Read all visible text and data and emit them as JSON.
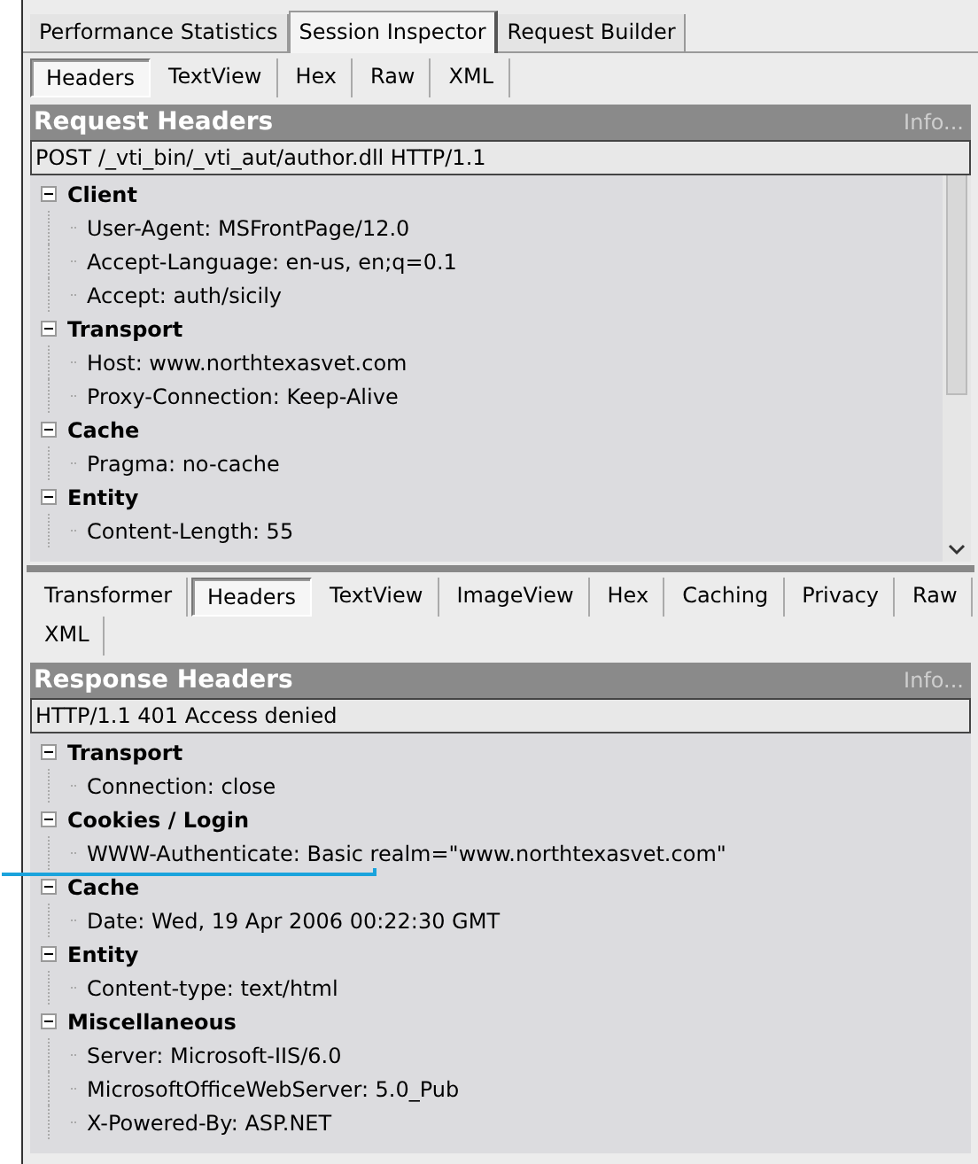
{
  "main_tabs": [
    {
      "label": "Performance Statistics",
      "selected": false
    },
    {
      "label": "Session Inspector",
      "selected": true
    },
    {
      "label": "Request Builder",
      "selected": false
    }
  ],
  "request": {
    "tabs": [
      {
        "label": "Headers",
        "selected": true
      },
      {
        "label": "TextView",
        "selected": false
      },
      {
        "label": "Hex",
        "selected": false
      },
      {
        "label": "Raw",
        "selected": false
      },
      {
        "label": "XML",
        "selected": false
      }
    ],
    "title": "Request Headers",
    "info": "Info...",
    "status_line": "POST /_vti_bin/_vti_aut/author.dll HTTP/1.1",
    "tree": [
      {
        "label": "Client",
        "expanded": true,
        "children": [
          {
            "label": "User-Agent: MSFrontPage/12.0"
          },
          {
            "label": "Accept-Language: en-us, en;q=0.1"
          },
          {
            "label": "Accept: auth/sicily"
          }
        ]
      },
      {
        "label": "Transport",
        "expanded": true,
        "children": [
          {
            "label": "Host: www.northtexasvet.com"
          },
          {
            "label": "Proxy-Connection: Keep-Alive"
          }
        ]
      },
      {
        "label": "Cache",
        "expanded": true,
        "children": [
          {
            "label": "Pragma: no-cache"
          }
        ]
      },
      {
        "label": "Entity",
        "expanded": true,
        "children": [
          {
            "label": "Content-Length: 55"
          }
        ]
      }
    ]
  },
  "response": {
    "tabs": [
      {
        "label": "Transformer",
        "selected": false
      },
      {
        "label": "Headers",
        "selected": true
      },
      {
        "label": "TextView",
        "selected": false
      },
      {
        "label": "ImageView",
        "selected": false
      },
      {
        "label": "Hex",
        "selected": false
      },
      {
        "label": "Caching",
        "selected": false
      },
      {
        "label": "Privacy",
        "selected": false
      },
      {
        "label": "Raw",
        "selected": false
      },
      {
        "label": "XML",
        "selected": false
      }
    ],
    "title": "Response Headers",
    "info": "Info...",
    "status_line": "HTTP/1.1 401 Access denied",
    "tree": [
      {
        "label": "Transport",
        "expanded": true,
        "children": [
          {
            "label": "Connection: close"
          }
        ]
      },
      {
        "label": "Cookies / Login",
        "expanded": true,
        "children": [
          {
            "label": "WWW-Authenticate: Basic realm=\"www.northtexasvet.com\""
          }
        ]
      },
      {
        "label": "Cache",
        "expanded": true,
        "children": [
          {
            "label": "Date: Wed, 19 Apr 2006 00:22:30 GMT"
          }
        ]
      },
      {
        "label": "Entity",
        "expanded": true,
        "children": [
          {
            "label": "Content-type: text/html"
          }
        ]
      },
      {
        "label": "Miscellaneous",
        "expanded": true,
        "children": [
          {
            "label": "Server: Microsoft-IIS/6.0"
          },
          {
            "label": "MicrosoftOfficeWebServer: 5.0_Pub"
          },
          {
            "label": "X-Powered-By: ASP.NET"
          }
        ]
      }
    ]
  }
}
